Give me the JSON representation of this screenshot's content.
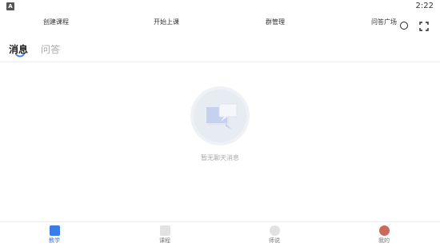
{
  "status_bar": {
    "badge": "A",
    "time": "2:22"
  },
  "top_actions": [
    {
      "label": "创建课程"
    },
    {
      "label": "开始上课"
    },
    {
      "label": "群管理"
    },
    {
      "label": "问答广场"
    }
  ],
  "tabs": [
    {
      "label": "消息",
      "active": true
    },
    {
      "label": "问答",
      "active": false
    }
  ],
  "empty_state": {
    "text": "暂无聊天消息"
  },
  "bottom_nav": [
    {
      "label": "教学",
      "icon": "teach-icon",
      "active": true
    },
    {
      "label": "课程",
      "icon": "course-icon",
      "active": false
    },
    {
      "label": "师说",
      "icon": "talk-icon",
      "active": false
    },
    {
      "label": "我的",
      "icon": "avatar",
      "active": false
    }
  ],
  "colors": {
    "accent": "#3a7de8",
    "muted": "#aaaaaa"
  }
}
